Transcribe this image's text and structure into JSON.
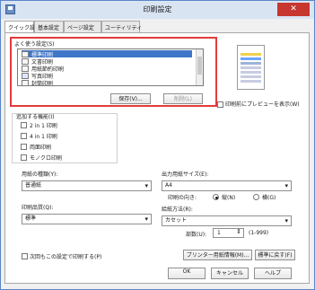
{
  "window": {
    "title": "印刷設定",
    "close_glyph": "✕"
  },
  "tabs": [
    "クイック設定",
    "基本設定",
    "ページ設定",
    "ユーティリティ"
  ],
  "favorites": {
    "label": "よく使う設定(S)",
    "items": [
      "標準印刷",
      "文書印刷",
      "用紙節約印刷",
      "写真印刷",
      "封筒印刷"
    ],
    "selected_index": 0,
    "save_button": "保存(V)...",
    "delete_button": "削除(L)"
  },
  "preview": {
    "checkbox_label": "印刷前にプレビューを表示(W)"
  },
  "functions": {
    "label": "追加する機能(I)",
    "items": [
      "2 in 1 印刷",
      "4 in 1 印刷",
      "両面印刷",
      "モノクロ印刷"
    ]
  },
  "paper_type": {
    "label": "用紙の種類(Y):",
    "value": "普通紙"
  },
  "print_quality": {
    "label": "印刷品質(Q):",
    "value": "標準"
  },
  "output_size": {
    "label": "出力用紙サイズ(E):",
    "value": "A4"
  },
  "orientation": {
    "label": "印刷の向き:",
    "portrait": "縦(N)",
    "landscape": "横(G)",
    "selected": "portrait"
  },
  "feed_method": {
    "label": "給紙方法(R):",
    "value": "カセット"
  },
  "copies": {
    "label": "部数(U):",
    "value": "1",
    "range": "(1-999)"
  },
  "next_time_checkbox": "次回もこの設定で印刷する(P)",
  "buttons": {
    "printer_info": "プリンター用紙情報(M)...",
    "reset": "標準に戻す(F)",
    "ok": "OK",
    "cancel": "キャンセル",
    "help": "ヘルプ"
  }
}
